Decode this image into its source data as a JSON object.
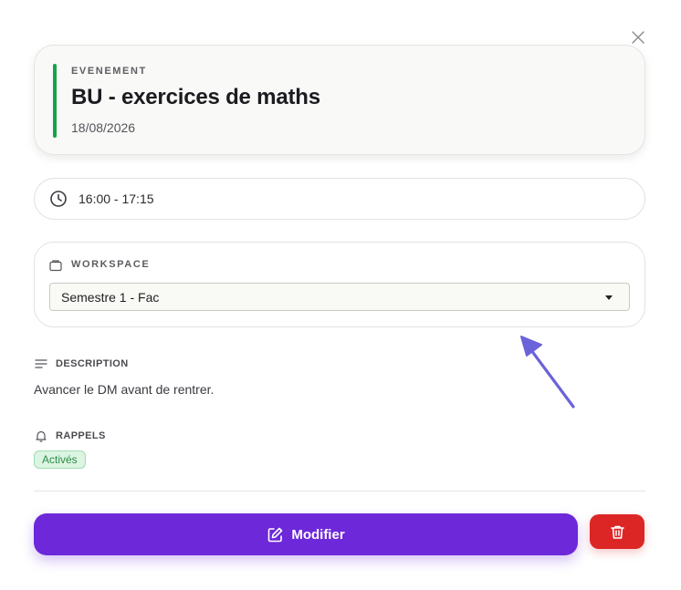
{
  "event": {
    "type_label": "EVENEMENT",
    "title": "BU - exercices de maths",
    "date": "18/08/2026",
    "accent_color": "#16a34a"
  },
  "time": {
    "icon": "clock-icon",
    "range": "16:00 - 17:15"
  },
  "workspace": {
    "icon": "folder-icon",
    "label": "WORKSPACE",
    "selected": "Semestre 1 - Fac"
  },
  "description": {
    "icon": "lines-icon",
    "label": "DESCRIPTION",
    "text": "Avancer le DM avant de rentrer."
  },
  "reminders": {
    "icon": "bell-icon",
    "label": "RAPPELS",
    "status": "Activés"
  },
  "actions": {
    "modify_label": "Modifier",
    "modify_color": "#6d28d9",
    "delete_color": "#dc2626"
  },
  "annotation": {
    "arrow_color": "#6b63d9"
  }
}
